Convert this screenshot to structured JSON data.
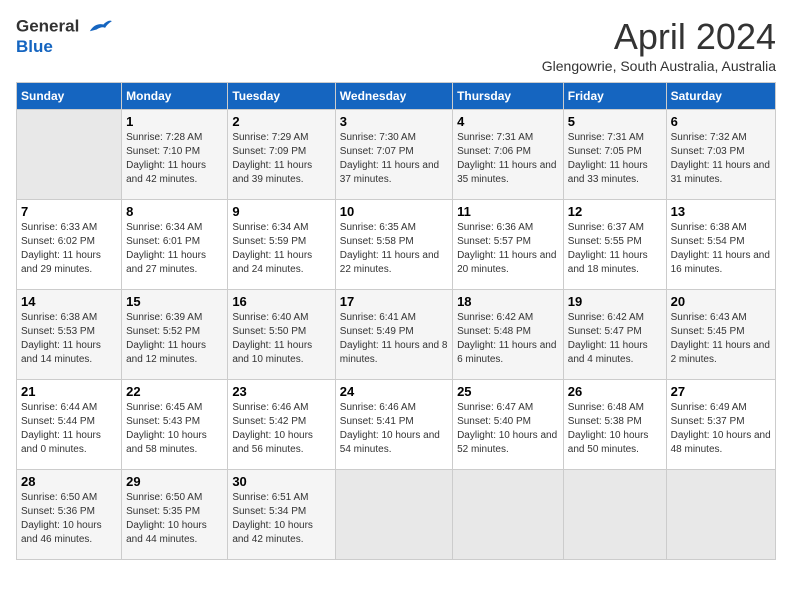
{
  "header": {
    "logo_line1": "General",
    "logo_line2": "Blue",
    "month": "April 2024",
    "location": "Glengowrie, South Australia, Australia"
  },
  "weekdays": [
    "Sunday",
    "Monday",
    "Tuesday",
    "Wednesday",
    "Thursday",
    "Friday",
    "Saturday"
  ],
  "weeks": [
    [
      {
        "day": "",
        "sunrise": "",
        "sunset": "",
        "daylight": ""
      },
      {
        "day": "1",
        "sunrise": "Sunrise: 7:28 AM",
        "sunset": "Sunset: 7:10 PM",
        "daylight": "Daylight: 11 hours and 42 minutes."
      },
      {
        "day": "2",
        "sunrise": "Sunrise: 7:29 AM",
        "sunset": "Sunset: 7:09 PM",
        "daylight": "Daylight: 11 hours and 39 minutes."
      },
      {
        "day": "3",
        "sunrise": "Sunrise: 7:30 AM",
        "sunset": "Sunset: 7:07 PM",
        "daylight": "Daylight: 11 hours and 37 minutes."
      },
      {
        "day": "4",
        "sunrise": "Sunrise: 7:31 AM",
        "sunset": "Sunset: 7:06 PM",
        "daylight": "Daylight: 11 hours and 35 minutes."
      },
      {
        "day": "5",
        "sunrise": "Sunrise: 7:31 AM",
        "sunset": "Sunset: 7:05 PM",
        "daylight": "Daylight: 11 hours and 33 minutes."
      },
      {
        "day": "6",
        "sunrise": "Sunrise: 7:32 AM",
        "sunset": "Sunset: 7:03 PM",
        "daylight": "Daylight: 11 hours and 31 minutes."
      }
    ],
    [
      {
        "day": "7",
        "sunrise": "Sunrise: 6:33 AM",
        "sunset": "Sunset: 6:02 PM",
        "daylight": "Daylight: 11 hours and 29 minutes."
      },
      {
        "day": "8",
        "sunrise": "Sunrise: 6:34 AM",
        "sunset": "Sunset: 6:01 PM",
        "daylight": "Daylight: 11 hours and 27 minutes."
      },
      {
        "day": "9",
        "sunrise": "Sunrise: 6:34 AM",
        "sunset": "Sunset: 5:59 PM",
        "daylight": "Daylight: 11 hours and 24 minutes."
      },
      {
        "day": "10",
        "sunrise": "Sunrise: 6:35 AM",
        "sunset": "Sunset: 5:58 PM",
        "daylight": "Daylight: 11 hours and 22 minutes."
      },
      {
        "day": "11",
        "sunrise": "Sunrise: 6:36 AM",
        "sunset": "Sunset: 5:57 PM",
        "daylight": "Daylight: 11 hours and 20 minutes."
      },
      {
        "day": "12",
        "sunrise": "Sunrise: 6:37 AM",
        "sunset": "Sunset: 5:55 PM",
        "daylight": "Daylight: 11 hours and 18 minutes."
      },
      {
        "day": "13",
        "sunrise": "Sunrise: 6:38 AM",
        "sunset": "Sunset: 5:54 PM",
        "daylight": "Daylight: 11 hours and 16 minutes."
      }
    ],
    [
      {
        "day": "14",
        "sunrise": "Sunrise: 6:38 AM",
        "sunset": "Sunset: 5:53 PM",
        "daylight": "Daylight: 11 hours and 14 minutes."
      },
      {
        "day": "15",
        "sunrise": "Sunrise: 6:39 AM",
        "sunset": "Sunset: 5:52 PM",
        "daylight": "Daylight: 11 hours and 12 minutes."
      },
      {
        "day": "16",
        "sunrise": "Sunrise: 6:40 AM",
        "sunset": "Sunset: 5:50 PM",
        "daylight": "Daylight: 11 hours and 10 minutes."
      },
      {
        "day": "17",
        "sunrise": "Sunrise: 6:41 AM",
        "sunset": "Sunset: 5:49 PM",
        "daylight": "Daylight: 11 hours and 8 minutes."
      },
      {
        "day": "18",
        "sunrise": "Sunrise: 6:42 AM",
        "sunset": "Sunset: 5:48 PM",
        "daylight": "Daylight: 11 hours and 6 minutes."
      },
      {
        "day": "19",
        "sunrise": "Sunrise: 6:42 AM",
        "sunset": "Sunset: 5:47 PM",
        "daylight": "Daylight: 11 hours and 4 minutes."
      },
      {
        "day": "20",
        "sunrise": "Sunrise: 6:43 AM",
        "sunset": "Sunset: 5:45 PM",
        "daylight": "Daylight: 11 hours and 2 minutes."
      }
    ],
    [
      {
        "day": "21",
        "sunrise": "Sunrise: 6:44 AM",
        "sunset": "Sunset: 5:44 PM",
        "daylight": "Daylight: 11 hours and 0 minutes."
      },
      {
        "day": "22",
        "sunrise": "Sunrise: 6:45 AM",
        "sunset": "Sunset: 5:43 PM",
        "daylight": "Daylight: 10 hours and 58 minutes."
      },
      {
        "day": "23",
        "sunrise": "Sunrise: 6:46 AM",
        "sunset": "Sunset: 5:42 PM",
        "daylight": "Daylight: 10 hours and 56 minutes."
      },
      {
        "day": "24",
        "sunrise": "Sunrise: 6:46 AM",
        "sunset": "Sunset: 5:41 PM",
        "daylight": "Daylight: 10 hours and 54 minutes."
      },
      {
        "day": "25",
        "sunrise": "Sunrise: 6:47 AM",
        "sunset": "Sunset: 5:40 PM",
        "daylight": "Daylight: 10 hours and 52 minutes."
      },
      {
        "day": "26",
        "sunrise": "Sunrise: 6:48 AM",
        "sunset": "Sunset: 5:38 PM",
        "daylight": "Daylight: 10 hours and 50 minutes."
      },
      {
        "day": "27",
        "sunrise": "Sunrise: 6:49 AM",
        "sunset": "Sunset: 5:37 PM",
        "daylight": "Daylight: 10 hours and 48 minutes."
      }
    ],
    [
      {
        "day": "28",
        "sunrise": "Sunrise: 6:50 AM",
        "sunset": "Sunset: 5:36 PM",
        "daylight": "Daylight: 10 hours and 46 minutes."
      },
      {
        "day": "29",
        "sunrise": "Sunrise: 6:50 AM",
        "sunset": "Sunset: 5:35 PM",
        "daylight": "Daylight: 10 hours and 44 minutes."
      },
      {
        "day": "30",
        "sunrise": "Sunrise: 6:51 AM",
        "sunset": "Sunset: 5:34 PM",
        "daylight": "Daylight: 10 hours and 42 minutes."
      },
      {
        "day": "",
        "sunrise": "",
        "sunset": "",
        "daylight": ""
      },
      {
        "day": "",
        "sunrise": "",
        "sunset": "",
        "daylight": ""
      },
      {
        "day": "",
        "sunrise": "",
        "sunset": "",
        "daylight": ""
      },
      {
        "day": "",
        "sunrise": "",
        "sunset": "",
        "daylight": ""
      }
    ]
  ]
}
